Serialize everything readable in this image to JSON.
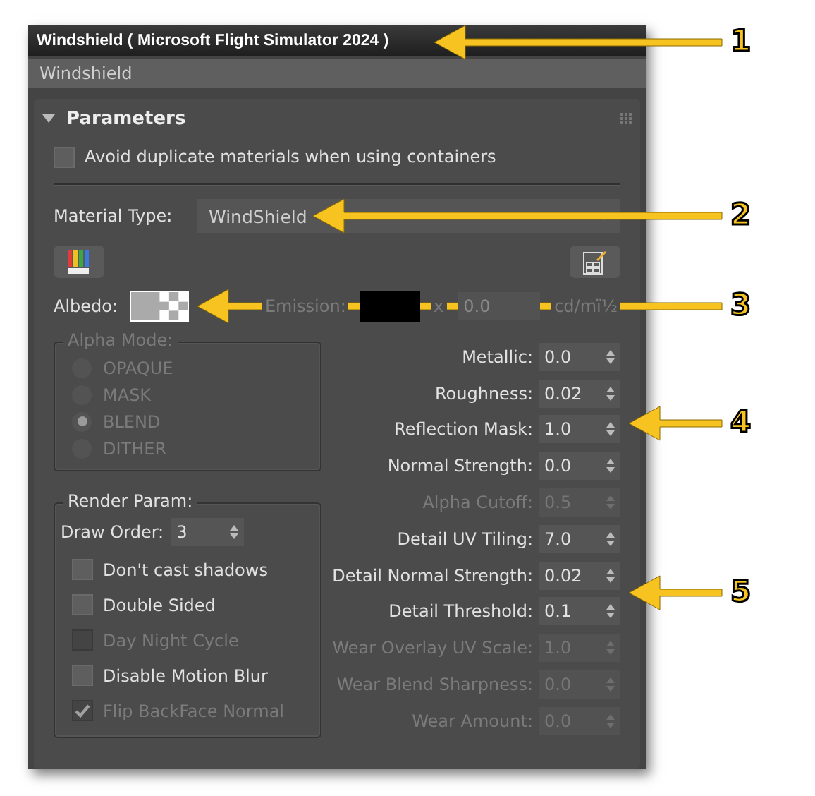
{
  "window": {
    "title": "Windshield  ( Microsoft Flight Simulator 2024 )"
  },
  "name_field": {
    "value": "Windshield"
  },
  "rollout": {
    "title": "Parameters",
    "expanded": true
  },
  "avoid_duplicates": {
    "label": "Avoid duplicate materials when using containers",
    "checked": false
  },
  "material_type": {
    "label": "Material Type:",
    "value": "WindShield"
  },
  "albedo": {
    "label": "Albedo:"
  },
  "emission": {
    "label": "Emission:",
    "multiplier": "x",
    "value": "0.0",
    "unit": "cd/mï½",
    "disabled": true
  },
  "alpha_mode": {
    "title": "Alpha Mode:",
    "disabled": true,
    "options": [
      {
        "label": "OPAQUE",
        "selected": false
      },
      {
        "label": "MASK",
        "selected": false
      },
      {
        "label": "BLEND",
        "selected": true
      },
      {
        "label": "DITHER",
        "selected": false
      }
    ]
  },
  "render_param": {
    "title": "Render Param:",
    "draw_order": {
      "label": "Draw Order:",
      "value": "3"
    },
    "options": [
      {
        "label": "Don't cast shadows",
        "checked": false,
        "disabled": false
      },
      {
        "label": "Double Sided",
        "checked": false,
        "disabled": false
      },
      {
        "label": "Day Night Cycle",
        "checked": false,
        "disabled": true
      },
      {
        "label": "Disable Motion Blur",
        "checked": false,
        "disabled": false
      },
      {
        "label": "Flip BackFace Normal",
        "checked": true,
        "disabled": true
      }
    ]
  },
  "params": [
    {
      "label": "Metallic:",
      "value": "0.0",
      "disabled": false
    },
    {
      "label": "Roughness:",
      "value": "0.02",
      "disabled": false
    },
    {
      "label": "Reflection Mask:",
      "value": "1.0",
      "disabled": false
    },
    {
      "label": "Normal Strength:",
      "value": "0.0",
      "disabled": false
    },
    {
      "label": "Alpha Cutoff:",
      "value": "0.5",
      "disabled": true
    },
    {
      "label": "Detail UV Tiling:",
      "value": "7.0",
      "disabled": false
    },
    {
      "label": "Detail Normal Strength:",
      "value": "0.02",
      "disabled": false
    },
    {
      "label": "Detail Threshold:",
      "value": "0.1",
      "disabled": false
    },
    {
      "label": "Wear Overlay UV Scale:",
      "value": "1.0",
      "disabled": true
    },
    {
      "label": "Wear Blend Sharpness:",
      "value": "0.0",
      "disabled": true
    },
    {
      "label": "Wear Amount:",
      "value": "0.0",
      "disabled": true
    }
  ],
  "callouts": [
    {
      "number": "1"
    },
    {
      "number": "2"
    },
    {
      "number": "3"
    },
    {
      "number": "4"
    },
    {
      "number": "5"
    }
  ]
}
